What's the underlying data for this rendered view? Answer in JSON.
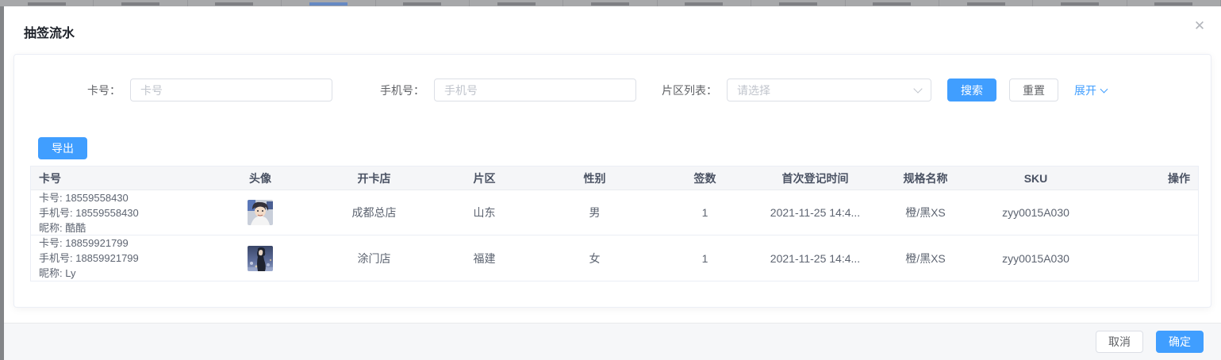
{
  "background_tabs": {
    "count": 13,
    "active_index": 3
  },
  "modal": {
    "title": "抽签流水",
    "close_icon": "✕"
  },
  "filters": {
    "card_no": {
      "label": "卡号：",
      "placeholder": "卡号",
      "value": ""
    },
    "phone": {
      "label": "手机号：",
      "placeholder": "手机号",
      "value": ""
    },
    "district": {
      "label": "片区列表：",
      "placeholder": "请选择",
      "value": ""
    },
    "search_label": "搜索",
    "reset_label": "重置",
    "expand_label": "展开"
  },
  "toolbar": {
    "export_label": "导出"
  },
  "table": {
    "headers": [
      "卡号",
      "头像",
      "开卡店",
      "片区",
      "性别",
      "签数",
      "首次登记时间",
      "规格名称",
      "SKU",
      "操作"
    ],
    "rows": [
      {
        "card_lines": [
          "卡号: 18559558430",
          "手机号: 18559558430",
          "昵称: 酷酷"
        ],
        "avatar": "avatar-anime-boy",
        "store": "成都总店",
        "district": "山东",
        "gender": "男",
        "sign_count": "1",
        "first_time": "2021-11-25 14:4...",
        "spec": "橙/黑XS",
        "sku": "zyy0015A030",
        "action": ""
      },
      {
        "card_lines": [
          "卡号: 18859921799",
          "手机号: 18859921799",
          "昵称: Ly"
        ],
        "avatar": "avatar-night-girl",
        "store": "涂门店",
        "district": "福建",
        "gender": "女",
        "sign_count": "1",
        "first_time": "2021-11-25 14:4...",
        "spec": "橙/黑XS",
        "sku": "zyy0015A030",
        "action": ""
      }
    ]
  },
  "footer": {
    "cancel_label": "取消",
    "confirm_label": "确定"
  },
  "colors": {
    "primary": "#409eff",
    "header_bg": "#f5f6f8",
    "border": "#ebeef5"
  }
}
